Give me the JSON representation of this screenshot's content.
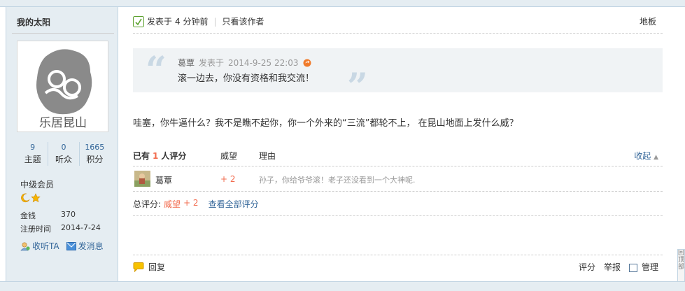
{
  "author": {
    "name": "我的太阳",
    "avatar_text": "乐居昆山",
    "stats": [
      {
        "num": "9",
        "label": "主题"
      },
      {
        "num": "0",
        "label": "听众"
      },
      {
        "num": "1665",
        "label": "积分"
      }
    ],
    "level": "中级会员",
    "money_label": "金钱",
    "money_value": "370",
    "regdate_label": "注册时间",
    "regdate_value": "2014-7-24",
    "follow_label": "收听TA",
    "message_label": "发消息"
  },
  "post": {
    "posted_prefix": "发表于",
    "posted_time": "4 分钟前",
    "only_author": "只看该作者",
    "floor": "地板",
    "quote": {
      "author": "葛覃",
      "posted_prefix": "发表于",
      "time": "2014-9-25 22:03",
      "text": "滚一边去，你没有资格和我交流！"
    },
    "content": "哇塞，你牛逼什么？我不是瞧不起你，你一个外来的“三流”都轮不上，  在昆山地面上发什么威？"
  },
  "rating": {
    "head_prefix": "已有",
    "head_count": "1",
    "head_suffix": "人评分",
    "col_prestige": "威望",
    "col_reason": "理由",
    "collapse": "收起",
    "rows": [
      {
        "user": "葛覃",
        "score": "+ 2",
        "reason": "孙子，你给爷爷滚！老子还没看到一个大神呢."
      }
    ],
    "total_label": "总评分:",
    "total_item": "威望",
    "total_value": "+ 2",
    "view_all": "查看全部评分"
  },
  "footer": {
    "reply": "回复",
    "rate": "评分",
    "report": "举报",
    "manage": "管理"
  },
  "backtop": "回顶部",
  "colors": {
    "sidebar_bg": "#e5edf2",
    "link": "#336699",
    "accent": "#f26c4f"
  }
}
